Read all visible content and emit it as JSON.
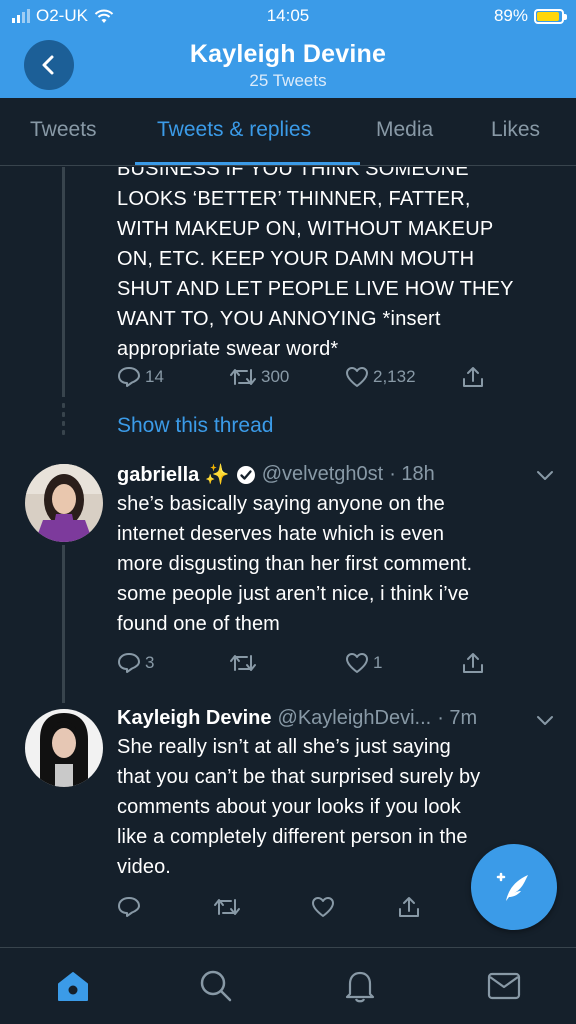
{
  "status_bar": {
    "carrier": "O2-UK",
    "time": "14:05",
    "battery": "89%",
    "battery_level": 0.89
  },
  "header": {
    "title": "Kayleigh Devine",
    "subtitle": "25 Tweets",
    "back_icon": "chevron-left-icon"
  },
  "tabs": [
    {
      "label": "Tweets",
      "active": false
    },
    {
      "label": "Tweets & replies",
      "active": true
    },
    {
      "label": "Media",
      "active": false
    },
    {
      "label": "Likes",
      "active": false
    }
  ],
  "tweet_partial": {
    "cut_line": "BUSINESS IF YOU THINK SOMEONE",
    "lines": [
      "LOOKS ‘BETTER’ THINNER, FATTER,",
      "WITH MAKEUP ON, WITHOUT MAKEUP",
      "ON, ETC. KEEP YOUR DAMN MOUTH",
      "SHUT AND LET PEOPLE LIVE HOW THEY",
      "WANT TO, YOU ANNOYING *insert",
      "appropriate swear word*"
    ],
    "replies": "14",
    "retweets": "300",
    "likes": "2,132",
    "show_thread": "Show this thread"
  },
  "tweet_gabriella": {
    "name": "gabriella ✨",
    "verified": true,
    "handle": "@velvetgh0st",
    "time": "· 18h",
    "lines": [
      "she’s basically saying anyone on the",
      "internet deserves hate which is even",
      "more disgusting than her first comment.",
      "some people just aren’t nice, i think i’ve",
      "found one of them"
    ],
    "replies": "3",
    "retweets": "",
    "likes": "1"
  },
  "tweet_kayleigh": {
    "name": "Kayleigh Devine",
    "handle": "@KayleighDevi...",
    "time": "· 7m",
    "lines": [
      "She really isn’t at all she’s just saying",
      "that you can’t be that surprised surely by",
      "comments about your looks if you look",
      "like a completely different person in the",
      "video."
    ]
  },
  "bottom_nav": [
    "home-icon",
    "search-icon",
    "notifications-icon",
    "messages-icon"
  ],
  "colors": {
    "accent": "#3b9be8",
    "background": "#15202b",
    "muted": "#8899a6",
    "divider": "#38444d"
  }
}
